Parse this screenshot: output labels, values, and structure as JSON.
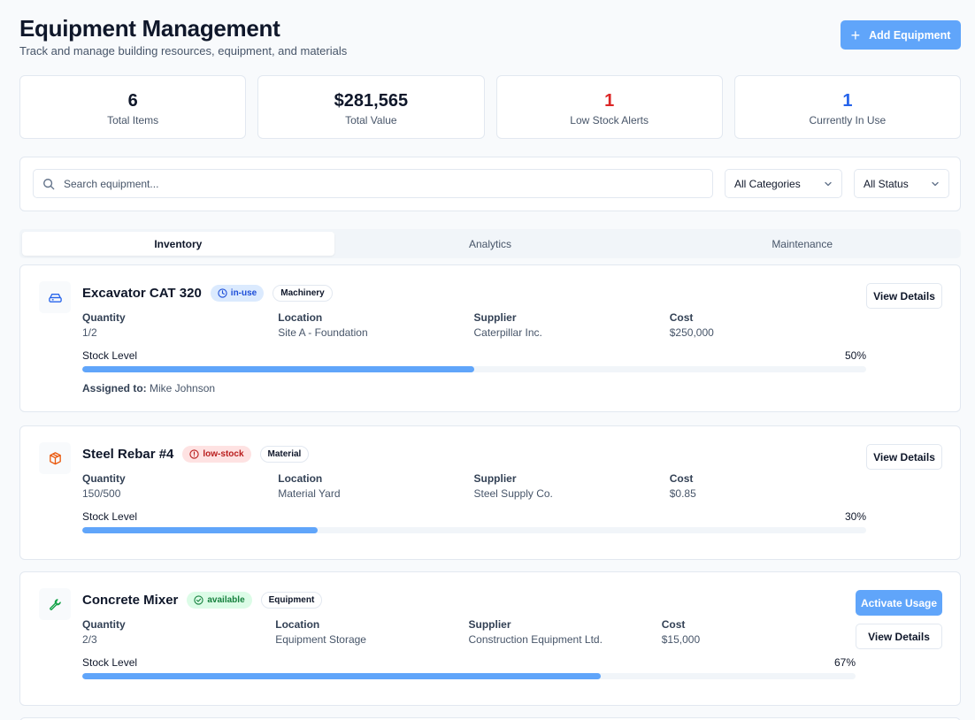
{
  "header": {
    "title": "Equipment Management",
    "subtitle": "Track and manage building resources, equipment, and materials",
    "add_button": "Add Equipment"
  },
  "stats": [
    {
      "value": "6",
      "label": "Total Items",
      "color": "#0f172a"
    },
    {
      "value": "$281,565",
      "label": "Total Value",
      "color": "#0f172a"
    },
    {
      "value": "1",
      "label": "Low Stock Alerts",
      "color": "#dc2626"
    },
    {
      "value": "1",
      "label": "Currently In Use",
      "color": "#2563eb"
    }
  ],
  "filters": {
    "search_placeholder": "Search equipment...",
    "category": "All Categories",
    "status": "All Status"
  },
  "tabs": [
    {
      "label": "Inventory",
      "active": true
    },
    {
      "label": "Analytics",
      "active": false
    },
    {
      "label": "Maintenance",
      "active": false
    }
  ],
  "labels": {
    "quantity": "Quantity",
    "location": "Location",
    "supplier": "Supplier",
    "cost": "Cost",
    "stock_level": "Stock Level",
    "assigned_to": "Assigned to:",
    "view_details": "View Details",
    "activate_usage": "Activate Usage"
  },
  "items": [
    {
      "name": "Excavator CAT 320",
      "icon": "machinery-icon",
      "status": "in-use",
      "category": "Machinery",
      "quantity": "1/2",
      "location": "Site A - Foundation",
      "supplier": "Caterpillar Inc.",
      "cost": "$250,000",
      "stock_percent": "50%",
      "stock_fill": 0.5,
      "assigned_to": "Mike Johnson"
    },
    {
      "name": "Steel Rebar #4",
      "icon": "package-icon",
      "status": "low-stock",
      "category": "Material",
      "quantity": "150/500",
      "location": "Material Yard",
      "supplier": "Steel Supply Co.",
      "cost": "$0.85",
      "stock_percent": "30%",
      "stock_fill": 0.3
    },
    {
      "name": "Concrete Mixer",
      "icon": "wrench-icon",
      "status": "available",
      "category": "Equipment",
      "quantity": "2/3",
      "location": "Equipment Storage",
      "supplier": "Construction Equipment Ltd.",
      "cost": "$15,000",
      "stock_percent": "67%",
      "stock_fill": 0.67
    }
  ]
}
